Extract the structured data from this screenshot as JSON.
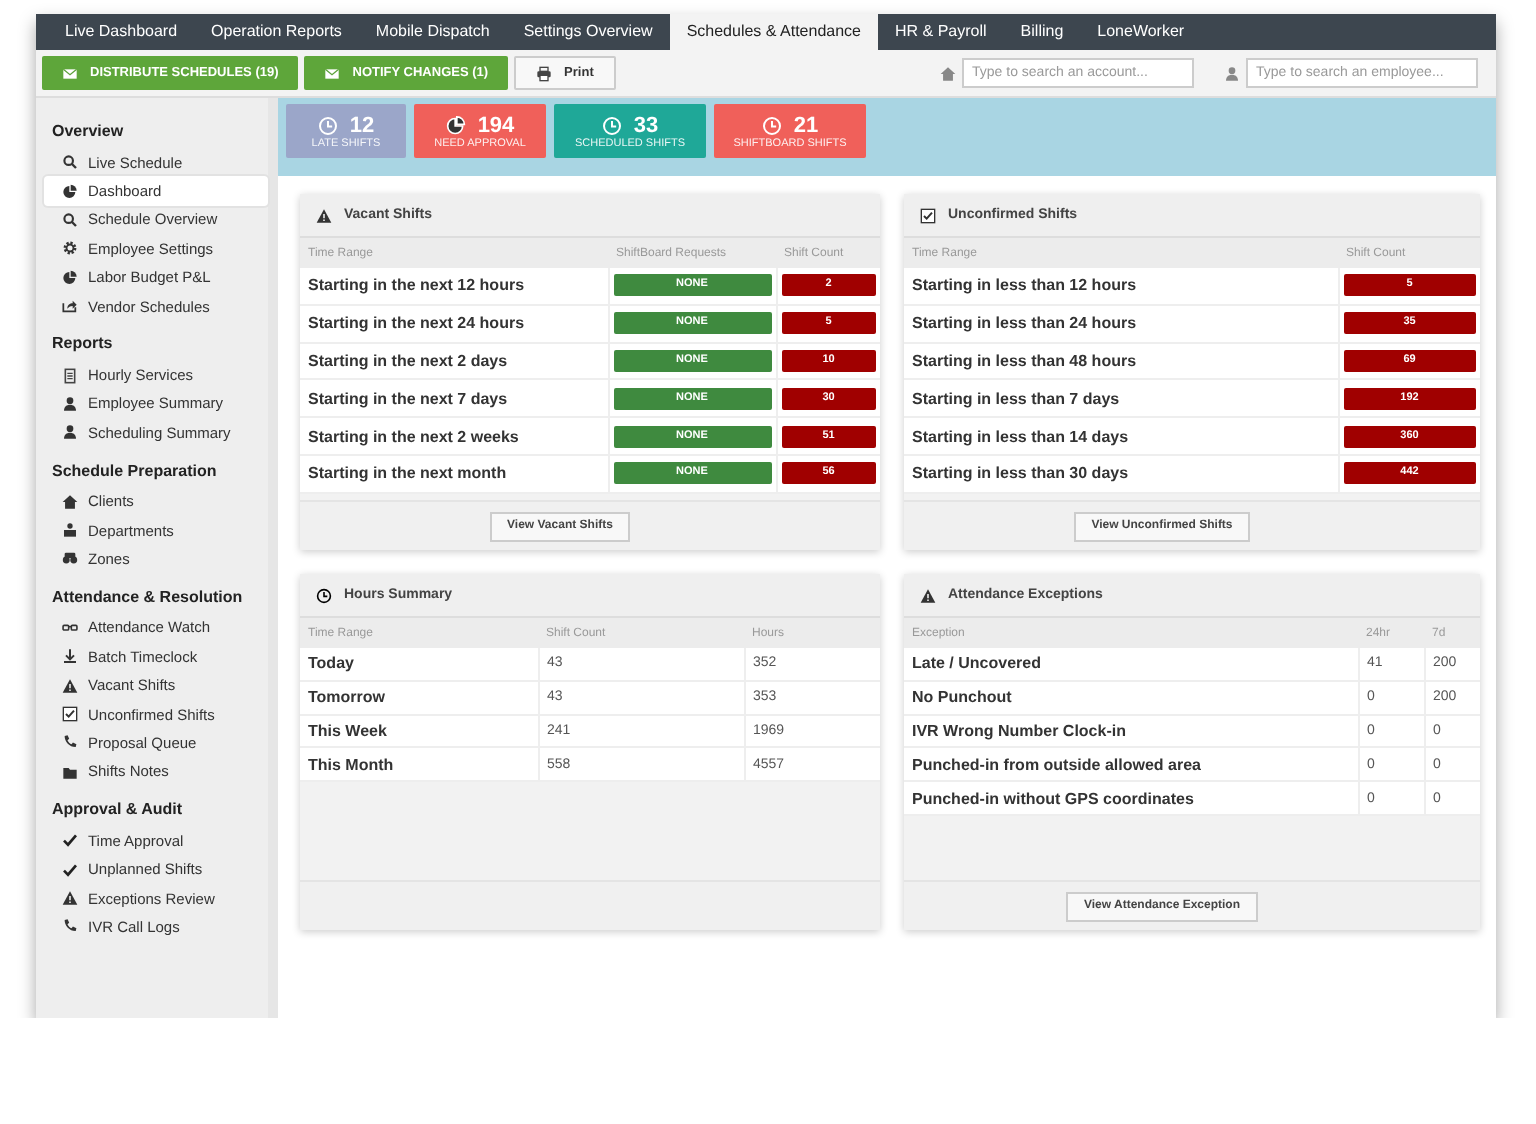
{
  "tabs": [
    {
      "label": "Live Dashboard",
      "selected": false
    },
    {
      "label": "Operation Reports",
      "selected": false
    },
    {
      "label": "Mobile Dispatch",
      "selected": false
    },
    {
      "label": "Settings Overview",
      "selected": false
    },
    {
      "label": "Schedules & Attendance",
      "selected": true
    },
    {
      "label": "HR & Payroll",
      "selected": false
    },
    {
      "label": "Billing",
      "selected": false
    },
    {
      "label": "LoneWorker",
      "selected": false
    }
  ],
  "toolbar": {
    "buttons": [
      {
        "label": "DISTRIBUTE SCHEDULES (19)",
        "kind": "primary"
      },
      {
        "label": "NOTIFY CHANGES (1)",
        "kind": "primary"
      },
      {
        "label": "Print",
        "kind": "plain"
      }
    ],
    "account_search": {
      "placeholder": "Type to search an account..."
    },
    "employee_search": {
      "placeholder": "Type to search an employee..."
    }
  },
  "sidebar": {
    "sections": [
      {
        "title": "Overview",
        "items": [
          {
            "label": "Live Schedule",
            "selected": false
          },
          {
            "label": "Dashboard",
            "selected": true
          },
          {
            "label": "Schedule Overview",
            "selected": false
          },
          {
            "label": "Employee Settings",
            "selected": false
          },
          {
            "label": "Labor Budget P&L",
            "selected": false
          },
          {
            "label": "Vendor Schedules",
            "selected": false
          }
        ]
      },
      {
        "title": "Reports",
        "items": [
          {
            "label": "Hourly Services",
            "selected": false
          },
          {
            "label": "Employee Summary",
            "selected": false
          },
          {
            "label": "Scheduling Summary",
            "selected": false
          }
        ]
      },
      {
        "title": "Schedule Preparation",
        "items": [
          {
            "label": "Clients",
            "selected": false
          },
          {
            "label": "Departments",
            "selected": false
          },
          {
            "label": "Zones",
            "selected": false
          }
        ]
      },
      {
        "title": "Attendance & Resolution",
        "items": [
          {
            "label": "Attendance Watch",
            "selected": false
          },
          {
            "label": "Batch Timeclock",
            "selected": false
          },
          {
            "label": "Vacant Shifts",
            "selected": false
          },
          {
            "label": "Unconfirmed Shifts",
            "selected": false
          },
          {
            "label": "Proposal Queue",
            "selected": false
          },
          {
            "label": "Shifts Notes",
            "selected": false
          }
        ]
      },
      {
        "title": "Approval & Audit",
        "items": [
          {
            "label": "Time Approval",
            "selected": false
          },
          {
            "label": "Unplanned Shifts",
            "selected": false
          },
          {
            "label": "Exceptions Review",
            "selected": false
          },
          {
            "label": "IVR Call Logs",
            "selected": false
          }
        ]
      }
    ]
  },
  "stats": [
    {
      "value": "12",
      "label": "LATE SHIFTS",
      "color": "#9ba6c9"
    },
    {
      "value": "194",
      "label": "NEED APPROVAL",
      "color": "#f0605a"
    },
    {
      "value": "33",
      "label": "SCHEDULED SHIFTS",
      "color": "#1fa898"
    },
    {
      "value": "21",
      "label": "SHIFTBOARD SHIFTS",
      "color": "#f0605a"
    }
  ],
  "panels": [
    {
      "title": "Vacant Shifts",
      "columns": [
        {
          "label": "Time Range",
          "kind": "label"
        },
        {
          "label": "ShiftBoard Requests",
          "kind": "ok-badge"
        },
        {
          "label": "Shift Count",
          "kind": "alert-badge"
        }
      ],
      "rows": [
        [
          "Starting in the next 12 hours",
          "NONE",
          "2"
        ],
        [
          "Starting in the next 24 hours",
          "NONE",
          "5"
        ],
        [
          "Starting in the next 2 days",
          "NONE",
          "10"
        ],
        [
          "Starting in the next 7 days",
          "NONE",
          "30"
        ],
        [
          "Starting in the next 2 weeks",
          "NONE",
          "51"
        ],
        [
          "Starting in the next month",
          "NONE",
          "56"
        ]
      ],
      "button": "View Vacant Shifts"
    },
    {
      "title": "Unconfirmed Shifts",
      "columns": [
        {
          "label": "Time Range",
          "kind": "label"
        },
        {
          "label": "Shift Count",
          "kind": "alert-badge"
        }
      ],
      "rows": [
        [
          "Starting in less than 12 hours",
          "5"
        ],
        [
          "Starting in less than 24 hours",
          "35"
        ],
        [
          "Starting in less than 48 hours",
          "69"
        ],
        [
          "Starting in less than 7 days",
          "192"
        ],
        [
          "Starting in less than 14 days",
          "360"
        ],
        [
          "Starting in less than 30 days",
          "442"
        ]
      ],
      "button": "View Unconfirmed Shifts"
    },
    {
      "title": "Hours Summary",
      "columns": [
        {
          "label": "Time Range",
          "kind": "label"
        },
        {
          "label": "Shift Count",
          "kind": "value"
        },
        {
          "label": "Hours",
          "kind": "value"
        }
      ],
      "rows": [
        [
          "Today",
          "43",
          "352"
        ],
        [
          "Tomorrow",
          "43",
          "353"
        ],
        [
          "This Week",
          "241",
          "1969"
        ],
        [
          "This Month",
          "558",
          "4557"
        ]
      ]
    },
    {
      "title": "Attendance Exceptions",
      "columns": [
        {
          "label": "Exception",
          "kind": "label"
        },
        {
          "label": "24hr",
          "kind": "value"
        },
        {
          "label": "7d",
          "kind": "value"
        }
      ],
      "rows": [
        [
          "Late / Uncovered",
          "41",
          "200"
        ],
        [
          "No Punchout",
          "0",
          "200"
        ],
        [
          "IVR Wrong Number Clock-in",
          "0",
          "0"
        ],
        [
          "Punched-in from outside allowed area",
          "0",
          "0"
        ],
        [
          "Punched-in without GPS coordinates",
          "0",
          "0"
        ]
      ],
      "button": "View Attendance Exception"
    }
  ]
}
